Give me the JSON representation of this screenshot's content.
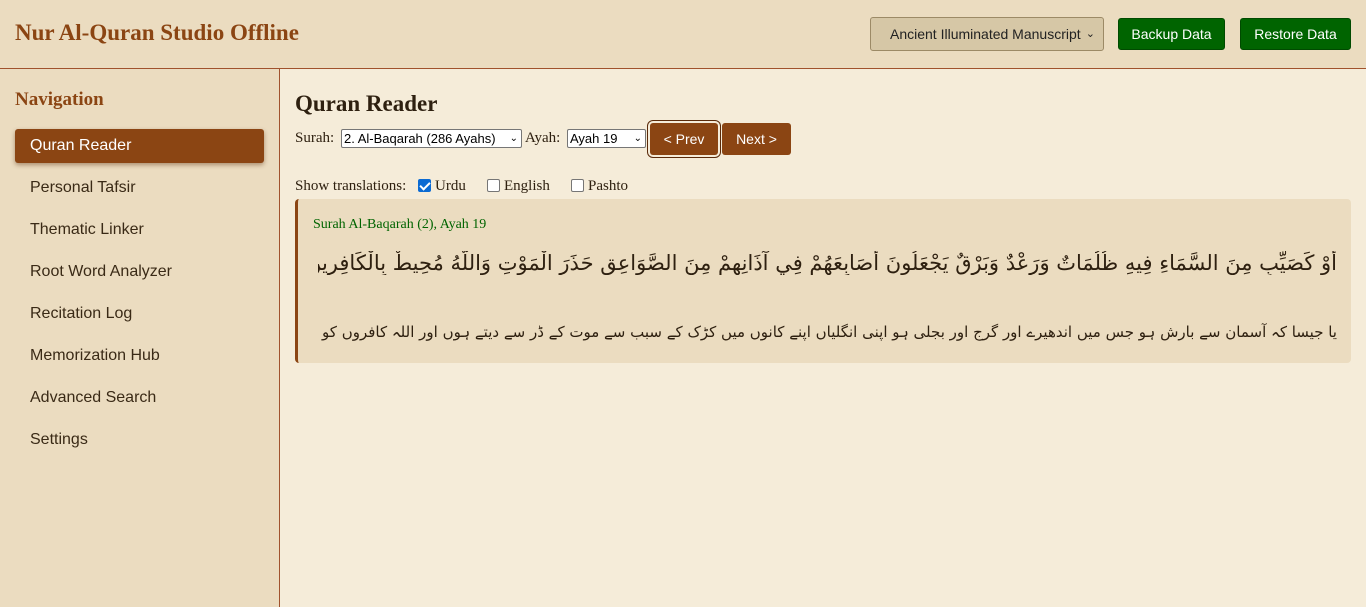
{
  "header": {
    "app_title": "Nur Al-Quran Studio Offline",
    "theme_selected": "Ancient Illuminated Manuscript",
    "backup_label": "Backup Data",
    "restore_label": "Restore Data"
  },
  "sidebar": {
    "title": "Navigation",
    "items": [
      {
        "label": "Quran Reader",
        "active": true
      },
      {
        "label": "Personal Tafsir"
      },
      {
        "label": "Thematic Linker"
      },
      {
        "label": "Root Word Analyzer"
      },
      {
        "label": "Recitation Log"
      },
      {
        "label": "Memorization Hub"
      },
      {
        "label": "Advanced Search"
      },
      {
        "label": "Settings"
      }
    ]
  },
  "main": {
    "title": "Quran Reader",
    "surah_label": "Surah:",
    "surah_selected": "2. Al-Baqarah (286 Ayahs)",
    "ayah_label": "Ayah:",
    "ayah_selected": "Ayah 19",
    "prev_label": "< Prev",
    "next_label": "Next >",
    "translations_label": "Show translations:",
    "translations": [
      {
        "label": "Urdu",
        "checked": true
      },
      {
        "label": "English",
        "checked": false
      },
      {
        "label": "Pashto",
        "checked": false
      }
    ],
    "ayah": {
      "reference": "Surah Al-Baqarah (2), Ayah 19",
      "arabic": "أَوْ كَصَيِّبٍ مِنَ السَّمَاءِ فِيهِ ظُلُمَاتٌ وَرَعْدٌ وَبَرْقٌ يَجْعَلُونَ أَصَابِعَهُمْ فِي آذَانِهِمْ مِنَ الصَّوَاعِقِ حَذَرَ الْمَوْتِ وَاللَّهُ مُحِيطٌ بِالْكَافِرِينَ",
      "urdu": "یا جیسا کہ آسمان سے بارش ہو جس میں اندھیرے اور گرج اور بجلی ہو اپنی انگلیاں اپنے کانوں میں کڑک کے سبب سے موت کے ڈر سے دیتے ہوں اور اللہ کافروں کو گھیرے ہوئے ہے"
    }
  },
  "colors": {
    "accent_brown": "#8b4513",
    "green": "#006400",
    "panel": "#ebdcc0",
    "background": "#f5ecd9"
  }
}
